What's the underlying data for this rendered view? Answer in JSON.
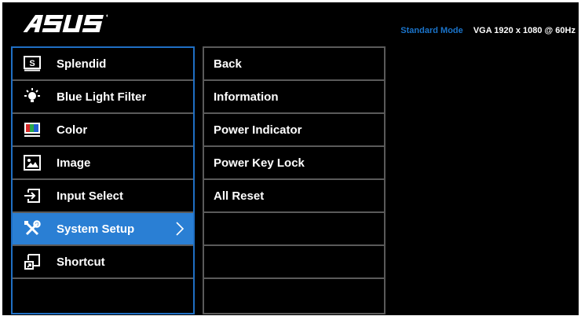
{
  "header": {
    "brand": "ASUS",
    "mode": "Standard Mode",
    "signal": "VGA  1920 x 1080 @ 60Hz"
  },
  "main_menu": [
    {
      "label": "Splendid",
      "icon": "splendid-icon"
    },
    {
      "label": "Blue Light Filter",
      "icon": "blue-light-icon"
    },
    {
      "label": "Color",
      "icon": "color-icon"
    },
    {
      "label": "Image",
      "icon": "image-icon"
    },
    {
      "label": "Input Select",
      "icon": "input-select-icon"
    },
    {
      "label": "System Setup",
      "icon": "wrench-screwdriver-icon",
      "selected": true
    },
    {
      "label": "Shortcut",
      "icon": "shortcut-icon"
    },
    {
      "label": ""
    }
  ],
  "submenu": [
    {
      "label": "Back"
    },
    {
      "label": "Information"
    },
    {
      "label": "Power Indicator"
    },
    {
      "label": "Power Key Lock"
    },
    {
      "label": "All Reset"
    },
    {
      "label": ""
    },
    {
      "label": ""
    },
    {
      "label": ""
    }
  ],
  "colors": {
    "background": "#000000",
    "accent": "#2a7fd4",
    "panel_border_active": "#1f6fc4",
    "divider": "#5a5a5a",
    "mode_text": "#1a73c9"
  }
}
